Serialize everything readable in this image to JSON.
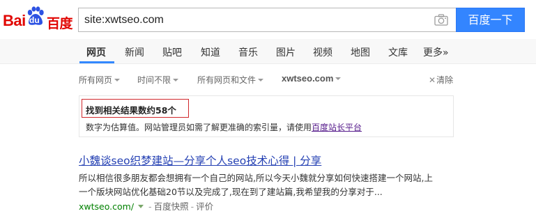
{
  "logo": {
    "bai": "Bai",
    "du": "du",
    "cn": "百度",
    "brand_red": "#e10602",
    "brand_blue": "#2d52e3"
  },
  "search": {
    "query": "site:xwtseo.com",
    "button_label": "百度一下",
    "camera_icon": "camera-icon",
    "button_color": "#3385ff"
  },
  "nav": {
    "tabs": [
      {
        "label": "网页",
        "active": true
      },
      {
        "label": "新闻"
      },
      {
        "label": "贴吧"
      },
      {
        "label": "知道"
      },
      {
        "label": "音乐"
      },
      {
        "label": "图片"
      },
      {
        "label": "视频"
      },
      {
        "label": "地图"
      },
      {
        "label": "文库"
      },
      {
        "label": "更多»"
      }
    ]
  },
  "filters": {
    "pages": "所有网页",
    "time": "时间不限",
    "file_type": "所有网页和文件",
    "site": "xwtseo.com",
    "clear": "清除"
  },
  "count_panel": {
    "count_text": "找到相关结果数约58个",
    "note_prefix": "数字为估算值。网站管理员如需了解更准确的索引量，请使用",
    "note_link": "百度站长平台",
    "highlight_color": "#d0272b"
  },
  "results": [
    {
      "title": "小魏谈seo织梦建站—分享个人seo技术心得 | 分享",
      "abstract_line1": "所以相信很多朋友都会想拥有一个自己的网站,所以今天小魏就分享如何快速搭建一个网站,上",
      "abstract_line2": "一个版块网站优化基础20节以及完成了,现在到了建站篇,我希望我的分享对于...",
      "url": "xwtseo.com/",
      "snapshot": "百度快照",
      "sep": "-",
      "review": "评价"
    }
  ]
}
